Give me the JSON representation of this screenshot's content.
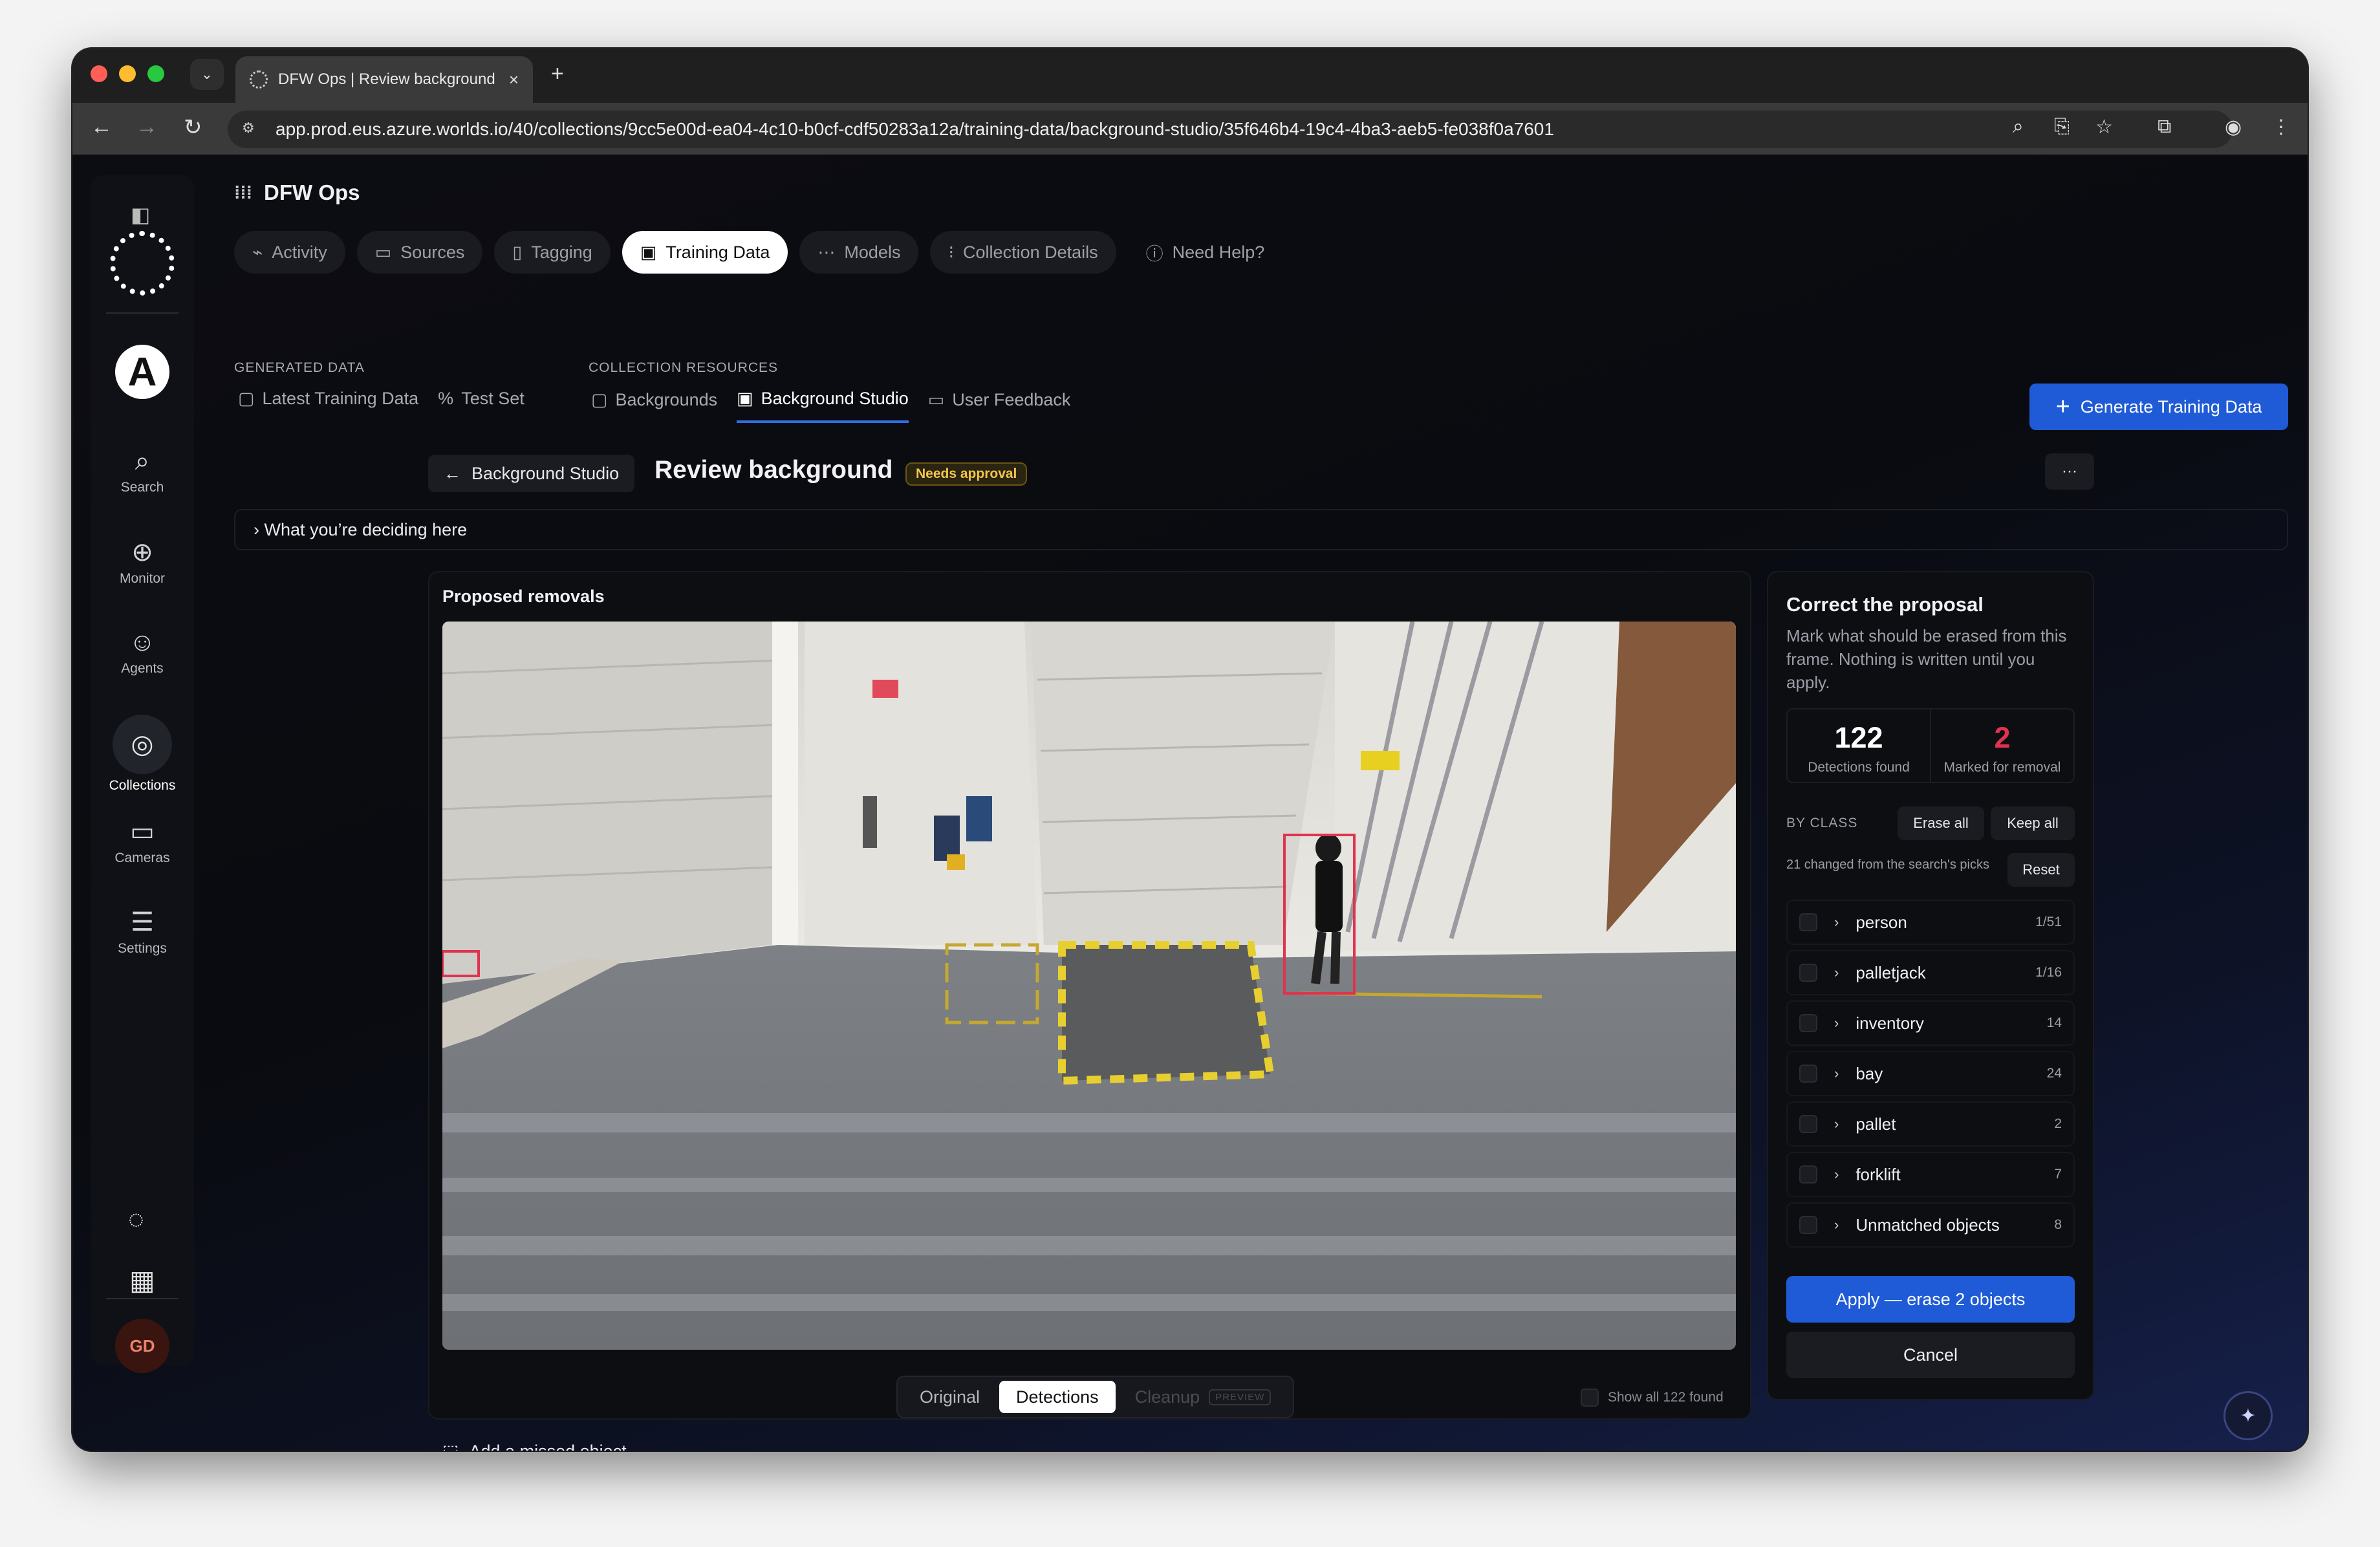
{
  "browser": {
    "tab_title": "DFW Ops | Review background",
    "url": "app.prod.eus.azure.worlds.io/40/collections/9cc5e00d-ea04-4c10-b0cf-cdf50283a12a/training-data/background-studio/35f646b4-19c4-4ba3-aeb5-fe038f0a7601",
    "new_tab": "+",
    "close": "×"
  },
  "rail": {
    "items": [
      {
        "label": "Search",
        "icon": "search-icon",
        "glyph": "⌕"
      },
      {
        "label": "Monitor",
        "icon": "monitor-icon",
        "glyph": "⊕"
      },
      {
        "label": "Agents",
        "icon": "robot-icon",
        "glyph": "☺"
      },
      {
        "label": "Collections",
        "icon": "collections-icon",
        "glyph": "◎"
      },
      {
        "label": "Cameras",
        "icon": "camera-icon",
        "glyph": "▭"
      },
      {
        "label": "Settings",
        "icon": "sliders-icon",
        "glyph": "☰"
      }
    ],
    "avatar": "GD",
    "logo_letter": "A"
  },
  "header": {
    "org": "DFW Ops",
    "tabs": [
      {
        "label": "Activity",
        "icon": "activity-icon",
        "glyph": "⌁"
      },
      {
        "label": "Sources",
        "icon": "sources-icon",
        "glyph": "▭"
      },
      {
        "label": "Tagging",
        "icon": "tag-icon",
        "glyph": "▯"
      },
      {
        "label": "Training Data",
        "icon": "training-data-icon",
        "glyph": "▣"
      },
      {
        "label": "Models",
        "icon": "models-icon",
        "glyph": "⋯"
      },
      {
        "label": "Collection Details",
        "icon": "details-icon",
        "glyph": "⁝"
      },
      {
        "label": "Need Help?",
        "icon": "help-icon",
        "glyph": "?"
      }
    ]
  },
  "subnav": {
    "generated_label": "GENERATED DATA",
    "resources_label": "COLLECTION RESOURCES",
    "generated": [
      {
        "label": "Latest Training Data",
        "glyph": "▢"
      },
      {
        "label": "Test Set",
        "glyph": "%"
      }
    ],
    "resources": [
      {
        "label": "Backgrounds",
        "glyph": "▢"
      },
      {
        "label": "Background Studio",
        "glyph": "▣"
      },
      {
        "label": "User Feedback",
        "glyph": "▭"
      }
    ],
    "generate_button": "Generate Training Data"
  },
  "page": {
    "back_label": "Background Studio",
    "title": "Review background",
    "status_badge": "Needs approval",
    "more": "···",
    "deciding": "› What you’re deciding here"
  },
  "viewer": {
    "title": "Proposed removals",
    "modes": [
      "Original",
      "Detections",
      "Cleanup"
    ],
    "active_mode": "Detections",
    "preview_tag": "PREVIEW",
    "show_all": "Show all 122 found",
    "add_missed": "Add a missed object"
  },
  "correct": {
    "title": "Correct the proposal",
    "description": "Mark what should be erased from this frame. Nothing is written until you apply.",
    "detections_found": "122",
    "detections_label": "Detections found",
    "marked": "2",
    "marked_label": "Marked for removal",
    "by_class": "BY CLASS",
    "erase_all": "Erase all",
    "keep_all": "Keep all",
    "changed_note": "21 changed from the search's picks",
    "reset": "Reset",
    "classes": [
      {
        "name": "person",
        "count": "1/51"
      },
      {
        "name": "palletjack",
        "count": "1/16"
      },
      {
        "name": "inventory",
        "count": "14"
      },
      {
        "name": "bay",
        "count": "24"
      },
      {
        "name": "pallet",
        "count": "2"
      },
      {
        "name": "forklift",
        "count": "7"
      },
      {
        "name": "Unmatched objects",
        "count": "8"
      }
    ],
    "apply": "Apply — erase 2 objects",
    "cancel": "Cancel"
  },
  "colors": {
    "accent": "#1f5bd6",
    "marked": "#e0334f",
    "badge": "#f2c54a"
  }
}
